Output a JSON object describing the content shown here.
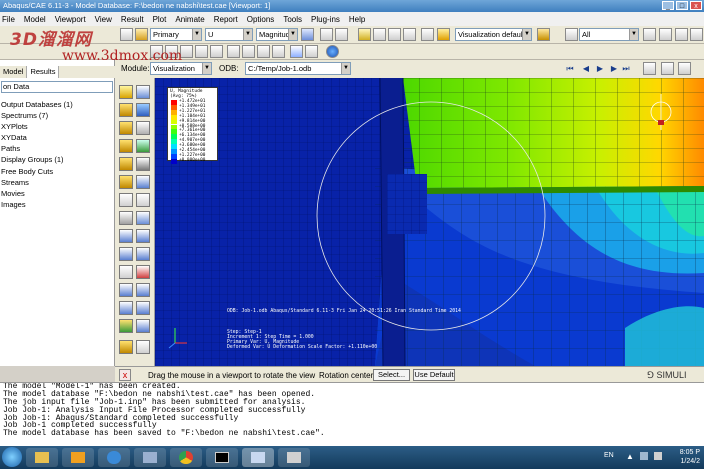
{
  "window": {
    "title": "Abaqus/CAE 6.11-3 - Model Database: F:\\bedon ne nabshi\\test.cae [Viewport: 1]",
    "controls": [
      "_",
      "□",
      "x"
    ]
  },
  "watermark": {
    "logo": "3D溜溜网",
    "url": "www.3dmox.com"
  },
  "menu": {
    "items": [
      "File",
      "Model",
      "Viewport",
      "View",
      "Result",
      "Plot",
      "Animate",
      "Report",
      "Options",
      "Tools",
      "Plug-ins",
      "Help"
    ]
  },
  "toolbar": {
    "primary_var": "Primary",
    "field_var": "U",
    "invariant": "Magnitude",
    "visualization": "Visualization defaults",
    "selection": "All"
  },
  "context": {
    "module_label": "Module:",
    "module_value": "Visualization",
    "odb_label": "ODB:",
    "odb_value": "C:/Temp/Job-1.odb"
  },
  "tree": {
    "tab_model": "Model",
    "tab_results": "Results",
    "selector": "on Data",
    "items": [
      "Output Databases (1)",
      "Spectrums (7)",
      "XYPlots",
      "XYData",
      "Paths",
      "Display Groups (1)",
      "Free Body Cuts",
      "Streams",
      "Movies",
      "Images"
    ]
  },
  "legend": {
    "title": "U, Magnitude",
    "subtitle": "(Avg: 75%)",
    "values": [
      "+1.472e+01",
      "+1.349e+01",
      "+1.227e+01",
      "+1.104e+01",
      "+9.814e+00",
      "+8.588e+00",
      "+7.361e+00",
      "+6.134e+00",
      "+4.907e+00",
      "+3.680e+00",
      "+2.454e+00",
      "+1.227e+00",
      "+0.000e+00"
    ],
    "colors": [
      "#ff0000",
      "#ff5a00",
      "#ffb000",
      "#ffe800",
      "#d8ff00",
      "#90ff00",
      "#3cff10",
      "#00ff5a",
      "#00ffb0",
      "#00e0ff",
      "#0090ff",
      "#0040ff",
      "#0000c8"
    ]
  },
  "viewport_info": {
    "odb_line": "ODB: Job-1.odb    Abaqus/Standard 6.11-3    Fri Jan 24 20:51:26 Iran Standard Time 2014",
    "step_line": "Step: Step-1",
    "increment_line": "Increment     1: Step Time =    1.000",
    "primary_line": "Primary Var: U, Magnitude",
    "deformed_line": "Deformed Var: U   Deformation Scale Factor: +1.110e+00"
  },
  "prompt": {
    "cancel": "x",
    "text": "Drag the mouse in a viewport to rotate the view",
    "rotation_label": "Rotation center:",
    "select_button": "Select...",
    "default_button": "Use Default",
    "brand": "SIMULI"
  },
  "messages": [
    "The model \"Model-1\" has been created.",
    "The model database \"F:\\bedon ne nabshi\\test.cae\" has been opened.",
    "The job input file \"Job-1.inp\" has been submitted for analysis.",
    "Job Job-1: Analysis Input File Processor completed successfully",
    "Job Job-1: Abaqus/Standard completed successfully",
    "Job Job-1 completed successfully",
    "The model database has been saved to \"F:\\bedon ne nabshi\\test.cae\"."
  ],
  "taskbar": {
    "lang": "EN",
    "time": "8:05 P",
    "date": "1/24/2"
  }
}
